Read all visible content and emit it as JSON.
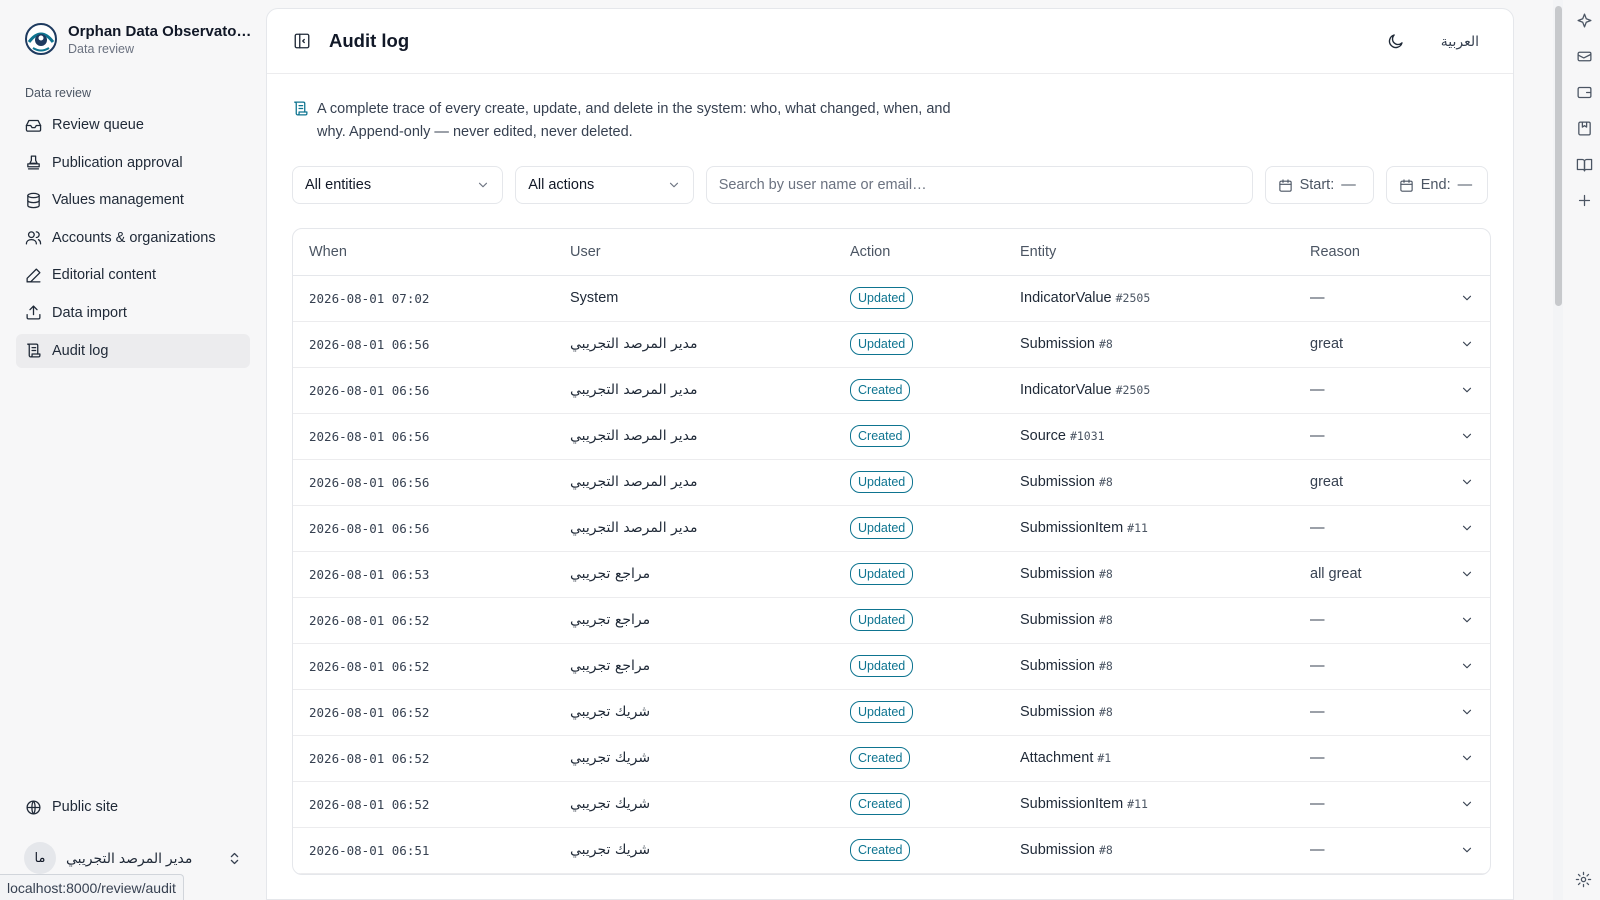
{
  "sidebar": {
    "brand_name": "Orphan Data Observato…",
    "brand_sub": "Data review",
    "section_label": "Data review",
    "items": [
      {
        "label": "Review queue"
      },
      {
        "label": "Publication approval"
      },
      {
        "label": "Values management"
      },
      {
        "label": "Accounts & organizations"
      },
      {
        "label": "Editorial content"
      },
      {
        "label": "Data import"
      },
      {
        "label": "Audit log"
      }
    ],
    "public_site": "Public site",
    "user_initials": "ما",
    "user_name": "مدير المرصد التجريبي"
  },
  "status_url": "localhost:8000/review/audit",
  "header": {
    "title": "Audit log",
    "language_toggle": "العربية"
  },
  "description": "A complete trace of every create, update, and delete in the system: who, what changed, when, and why. Append-only — never edited, never deleted.",
  "filters": {
    "entity_select": "All entities",
    "action_select": "All actions",
    "search_placeholder": "Search by user name or email…",
    "start_label": "Start:",
    "start_value": "—",
    "end_label": "End:",
    "end_value": "—"
  },
  "table": {
    "columns": [
      "When",
      "User",
      "Action",
      "Entity",
      "Reason"
    ],
    "rows": [
      {
        "when": "2026-08-01 07:02",
        "user": "System",
        "action": "Updated",
        "entity": "IndicatorValue",
        "id": "#2505",
        "reason": "—"
      },
      {
        "when": "2026-08-01 06:56",
        "user": "مدير المرصد التجريبي",
        "action": "Updated",
        "entity": "Submission",
        "id": "#8",
        "reason": "great"
      },
      {
        "when": "2026-08-01 06:56",
        "user": "مدير المرصد التجريبي",
        "action": "Created",
        "entity": "IndicatorValue",
        "id": "#2505",
        "reason": "—"
      },
      {
        "when": "2026-08-01 06:56",
        "user": "مدير المرصد التجريبي",
        "action": "Created",
        "entity": "Source",
        "id": "#1031",
        "reason": "—"
      },
      {
        "when": "2026-08-01 06:56",
        "user": "مدير المرصد التجريبي",
        "action": "Updated",
        "entity": "Submission",
        "id": "#8",
        "reason": "great"
      },
      {
        "when": "2026-08-01 06:56",
        "user": "مدير المرصد التجريبي",
        "action": "Updated",
        "entity": "SubmissionItem",
        "id": "#11",
        "reason": "—"
      },
      {
        "when": "2026-08-01 06:53",
        "user": "مراجع تجريبي",
        "action": "Updated",
        "entity": "Submission",
        "id": "#8",
        "reason": "all great"
      },
      {
        "when": "2026-08-01 06:52",
        "user": "مراجع تجريبي",
        "action": "Updated",
        "entity": "Submission",
        "id": "#8",
        "reason": "—"
      },
      {
        "when": "2026-08-01 06:52",
        "user": "مراجع تجريبي",
        "action": "Updated",
        "entity": "Submission",
        "id": "#8",
        "reason": "—"
      },
      {
        "when": "2026-08-01 06:52",
        "user": "شريك تجريبي",
        "action": "Updated",
        "entity": "Submission",
        "id": "#8",
        "reason": "—"
      },
      {
        "when": "2026-08-01 06:52",
        "user": "شريك تجريبي",
        "action": "Created",
        "entity": "Attachment",
        "id": "#1",
        "reason": "—"
      },
      {
        "when": "2026-08-01 06:52",
        "user": "شريك تجريبي",
        "action": "Created",
        "entity": "SubmissionItem",
        "id": "#11",
        "reason": "—"
      },
      {
        "when": "2026-08-01 06:51",
        "user": "شريك تجريبي",
        "action": "Created",
        "entity": "Submission",
        "id": "#8",
        "reason": "—"
      }
    ]
  },
  "colors": {
    "badge_accent": "#0e7490",
    "active_nav_bg": "#ececee",
    "page_bg": "#f7f7f8"
  },
  "icons": {
    "nav": [
      "inbox-icon",
      "stamp-icon",
      "database-icon",
      "users-icon",
      "pencil-icon",
      "upload-icon",
      "scroll-icon"
    ],
    "rail": [
      "sparkle-icon",
      "ticket-icon",
      "wallet-icon",
      "bookmark-icon",
      "book-open-icon",
      "plus-icon",
      "gear-icon"
    ]
  }
}
